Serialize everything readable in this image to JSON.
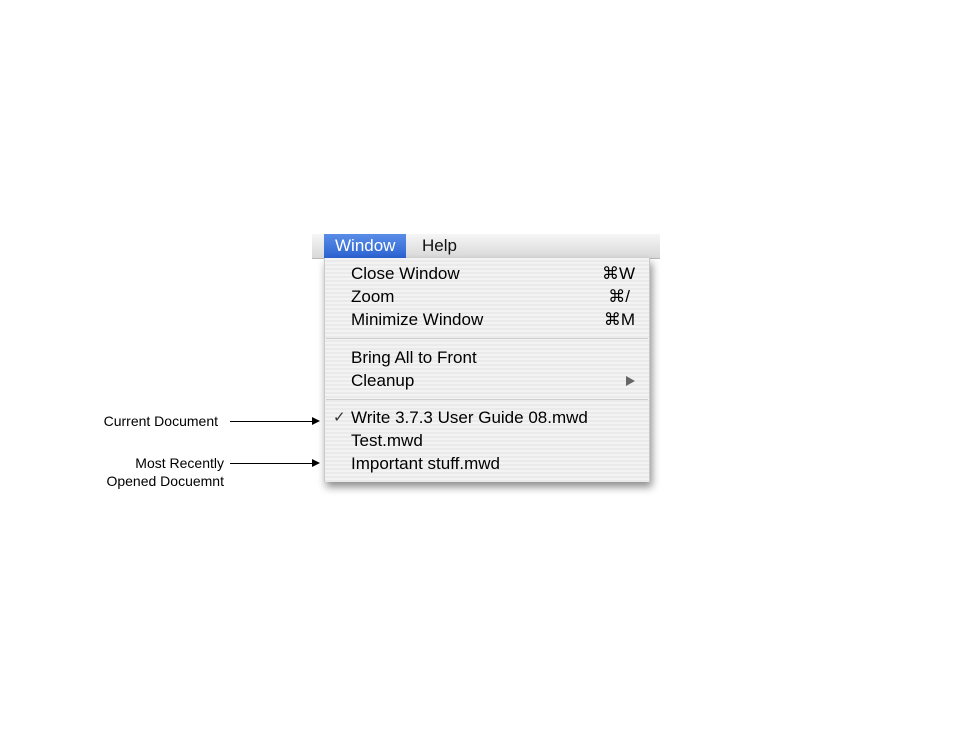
{
  "menubar": {
    "titles": [
      "Window",
      "Help"
    ]
  },
  "menu": {
    "items": [
      {
        "label": "Close Window",
        "shortcut": "⌘W"
      },
      {
        "label": "Zoom",
        "shortcut": "⌘/"
      },
      {
        "label": "Minimize Window",
        "shortcut": "⌘M"
      },
      {
        "label": "Bring All to Front"
      },
      {
        "label": "Cleanup",
        "submenu": true
      },
      {
        "label": "Write 3.7.3 User Guide 08.mwd",
        "checked": true,
        "check_glyph": "✓"
      },
      {
        "label": "Test.mwd"
      },
      {
        "label": "Important stuff.mwd"
      }
    ]
  },
  "annotations": {
    "current_document": "Current Document",
    "most_recent_line1": "Most Recently",
    "most_recent_line2": "Opened Docuemnt"
  }
}
